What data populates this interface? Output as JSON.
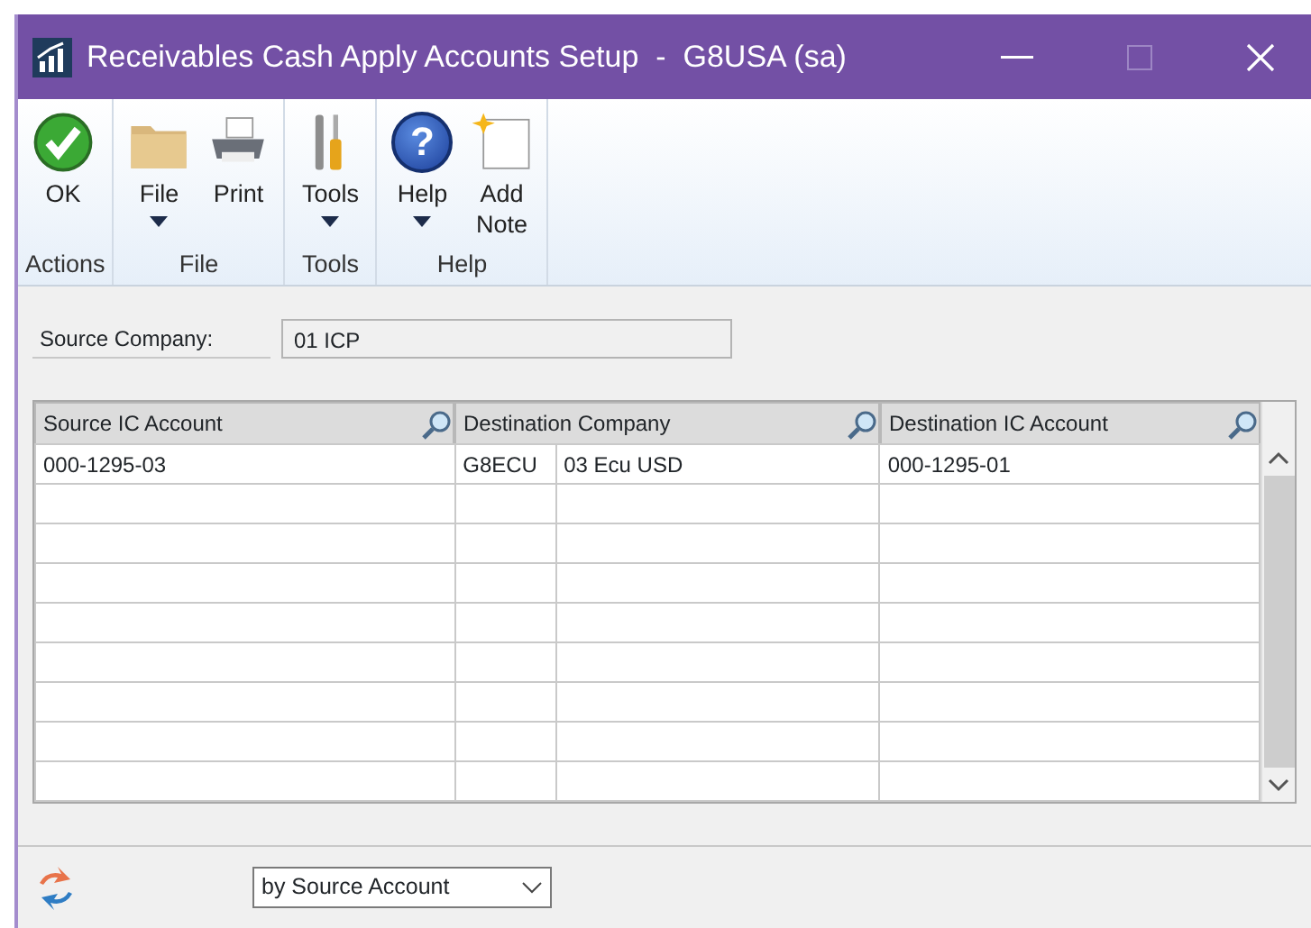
{
  "window": {
    "title": "Receivables Cash Apply Accounts Setup  -  G8USA (sa)"
  },
  "ribbon": {
    "groups": [
      {
        "label": "Actions",
        "buttons": [
          {
            "kind": "ok",
            "label": "OK",
            "dropdown": false
          }
        ]
      },
      {
        "label": "File",
        "buttons": [
          {
            "kind": "folder",
            "label": "File",
            "dropdown": true
          },
          {
            "kind": "printer",
            "label": "Print",
            "dropdown": false
          }
        ]
      },
      {
        "label": "Tools",
        "buttons": [
          {
            "kind": "tools",
            "label": "Tools",
            "dropdown": true
          }
        ]
      },
      {
        "label": "Help",
        "buttons": [
          {
            "kind": "help",
            "label": "Help",
            "dropdown": true,
            "glyph": "?"
          },
          {
            "kind": "note",
            "label": "Add Note",
            "dropdown": false
          }
        ]
      }
    ]
  },
  "source_company": {
    "label": "Source Company:",
    "value": "01 ICP"
  },
  "table": {
    "columns": [
      "Source IC Account",
      "Destination Company",
      "Destination IC Account"
    ],
    "rows": [
      {
        "source_ic_account": "000-1295-03",
        "destination_company": {
          "id": "G8ECU",
          "name": "03 Ecu USD"
        },
        "destination_ic_account": "000-1295-01"
      }
    ]
  },
  "sort": {
    "value": "by Source Account"
  }
}
